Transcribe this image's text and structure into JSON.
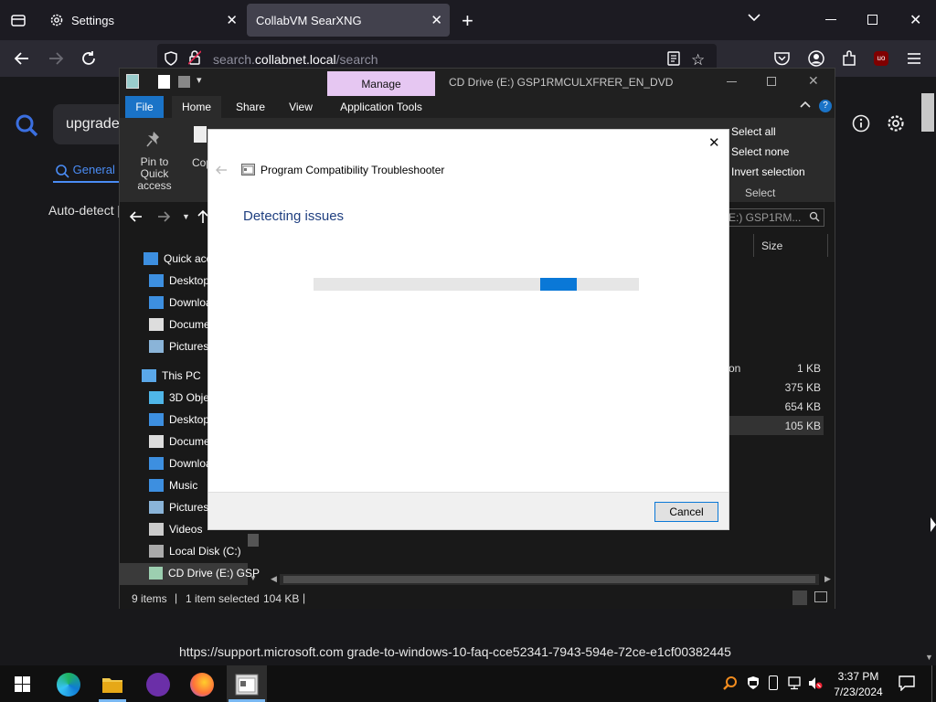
{
  "browser": {
    "tabs": [
      {
        "label": "Settings"
      },
      {
        "label": "CollabVM SearXNG"
      }
    ],
    "url": {
      "domain": "search.collabnet.local",
      "path": "/search"
    },
    "page": {
      "query": "upgrade",
      "category_tab": "General",
      "auto_detect": "Auto-detect [",
      "status_url": "https://support.microsoft.com  grade-to-windows-10-faq-cce52341-7943-594e-72ce-e1cf00382445"
    }
  },
  "explorer": {
    "title": "CD Drive (E:) GSP1RMCULXFRER_EN_DVD",
    "manage_tab": "Manage",
    "ribbon_tabs": [
      "File",
      "Home",
      "Share",
      "View",
      "Application Tools"
    ],
    "pin_label": "Pin to Quick access",
    "copy_label": "Cop",
    "select_items": [
      "Select all",
      "Select none",
      "Invert selection"
    ],
    "select_group": "Select",
    "address_tail": "E:) GSP1RM...",
    "size_column": "Size",
    "nav": [
      {
        "label": "Quick acc",
        "icon": "star-icon"
      },
      {
        "label": "Desktop",
        "icon": "desktop-icon"
      },
      {
        "label": "Downloa",
        "icon": "download-icon"
      },
      {
        "label": "Docume",
        "icon": "document-icon"
      },
      {
        "label": "Pictures",
        "icon": "pictures-icon"
      },
      {
        "label": "This PC",
        "icon": "pc-icon"
      },
      {
        "label": "3D Objec",
        "icon": "cube-icon"
      },
      {
        "label": "Desktop",
        "icon": "desktop-icon"
      },
      {
        "label": "Docume",
        "icon": "document-icon"
      },
      {
        "label": "Downloa",
        "icon": "download-icon"
      },
      {
        "label": "Music",
        "icon": "music-icon"
      },
      {
        "label": "Pictures",
        "icon": "pictures-icon"
      },
      {
        "label": "Videos",
        "icon": "video-icon"
      },
      {
        "label": "Local Disk (C:)",
        "icon": "disk-icon"
      },
      {
        "label": "CD Drive (E:) GSP",
        "icon": "cd-icon"
      }
    ],
    "file_fragment": "on",
    "sizes": [
      "1 KB",
      "375 KB",
      "654 KB",
      "105 KB"
    ],
    "status": {
      "items": "9 items",
      "selected": "1 item selected",
      "size": "104 KB"
    }
  },
  "dialog": {
    "title": "Program Compatibility Troubleshooter",
    "heading": "Detecting issues",
    "cancel_label": "Cancel",
    "progress_segment_start": 0.698,
    "progress_segment_width": 0.11
  },
  "taskbar": {
    "time": "3:37 PM",
    "date": "7/23/2024"
  }
}
